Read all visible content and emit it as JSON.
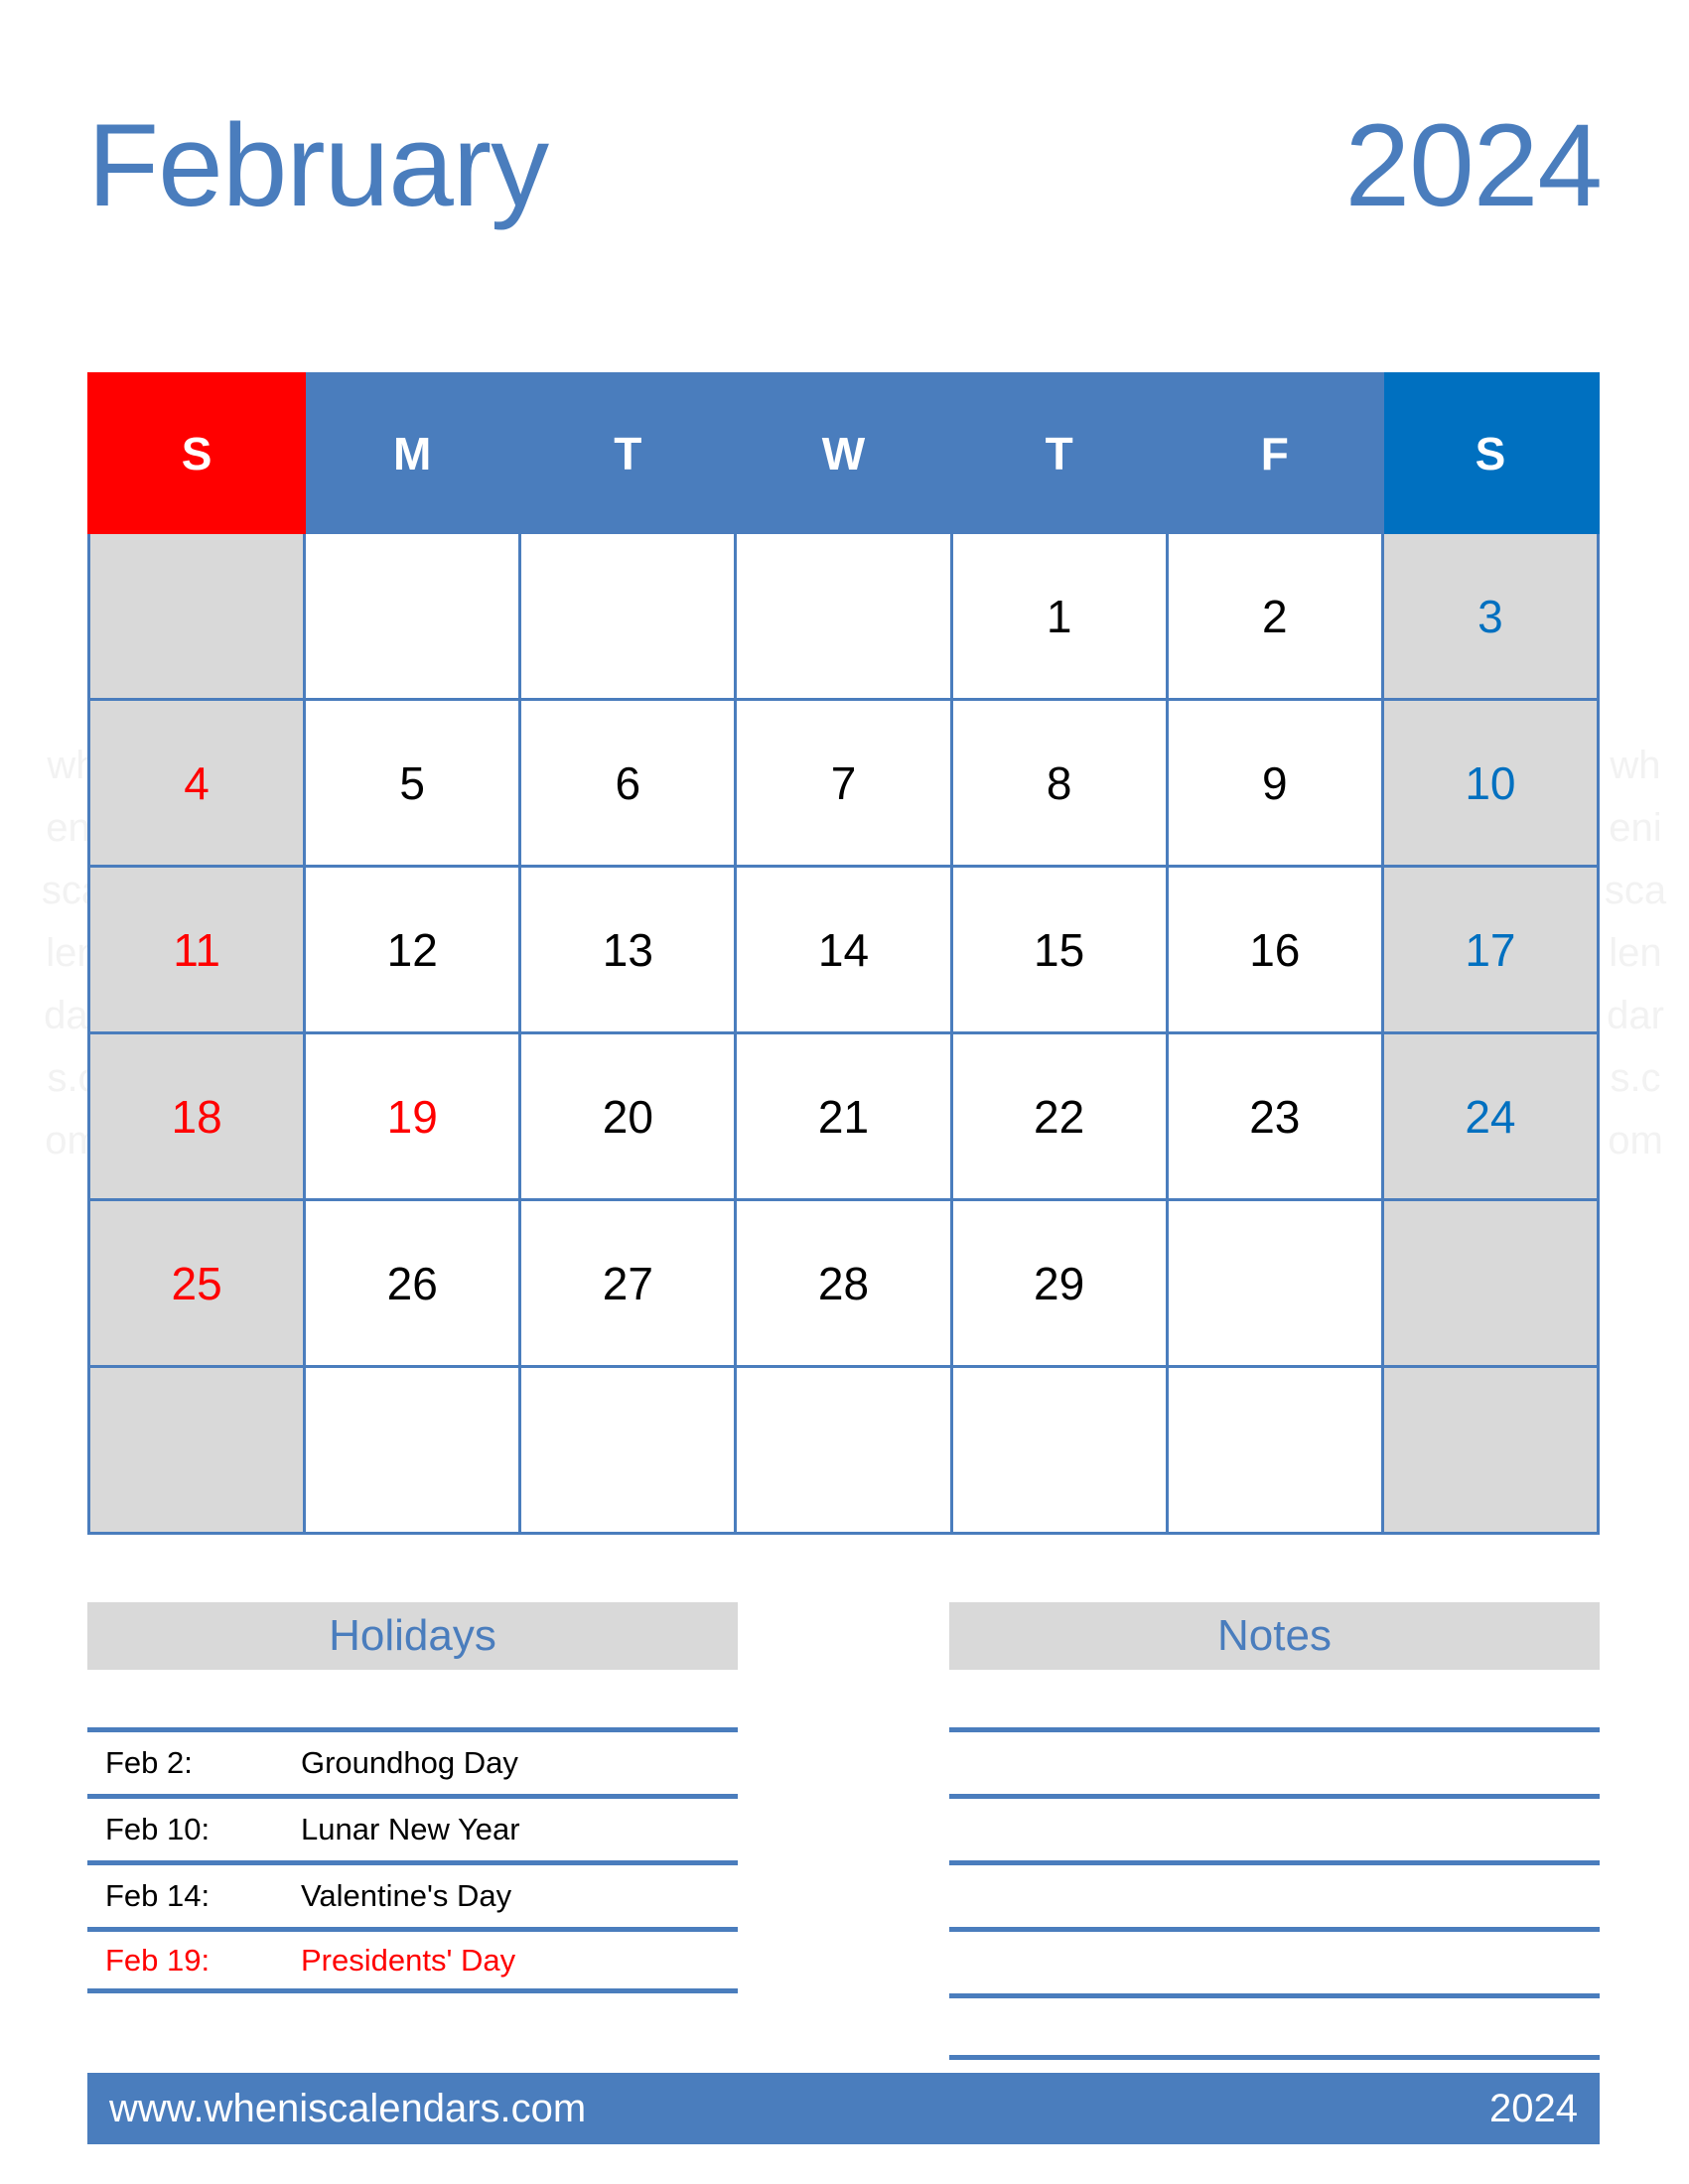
{
  "title": {
    "month": "February",
    "year": "2024"
  },
  "colors": {
    "accent_blue": "#4a7dbd",
    "saturday_blue": "#0070c0",
    "sunday_red": "#ff0000",
    "weekend_gray": "#d9d9d9",
    "panel_header_gray": "#d9d9d9"
  },
  "watermark": {
    "text": "wheniscalendars.com"
  },
  "calendar": {
    "weekday_headers": [
      {
        "label": "S",
        "kind": "sunday"
      },
      {
        "label": "M",
        "kind": "weekday"
      },
      {
        "label": "T",
        "kind": "weekday"
      },
      {
        "label": "W",
        "kind": "weekday"
      },
      {
        "label": "T",
        "kind": "weekday"
      },
      {
        "label": "F",
        "kind": "weekday"
      },
      {
        "label": "S",
        "kind": "saturday"
      }
    ],
    "weeks": [
      [
        {
          "day": "",
          "kind": "sunday"
        },
        {
          "day": "",
          "kind": "weekday"
        },
        {
          "day": "",
          "kind": "weekday"
        },
        {
          "day": "",
          "kind": "weekday"
        },
        {
          "day": "1",
          "kind": "weekday"
        },
        {
          "day": "2",
          "kind": "weekday"
        },
        {
          "day": "3",
          "kind": "saturday"
        }
      ],
      [
        {
          "day": "4",
          "kind": "sunday"
        },
        {
          "day": "5",
          "kind": "weekday"
        },
        {
          "day": "6",
          "kind": "weekday"
        },
        {
          "day": "7",
          "kind": "weekday"
        },
        {
          "day": "8",
          "kind": "weekday"
        },
        {
          "day": "9",
          "kind": "weekday"
        },
        {
          "day": "10",
          "kind": "saturday"
        }
      ],
      [
        {
          "day": "11",
          "kind": "sunday"
        },
        {
          "day": "12",
          "kind": "weekday"
        },
        {
          "day": "13",
          "kind": "weekday"
        },
        {
          "day": "14",
          "kind": "weekday"
        },
        {
          "day": "15",
          "kind": "weekday"
        },
        {
          "day": "16",
          "kind": "weekday"
        },
        {
          "day": "17",
          "kind": "saturday"
        }
      ],
      [
        {
          "day": "18",
          "kind": "sunday"
        },
        {
          "day": "19",
          "kind": "holiday"
        },
        {
          "day": "20",
          "kind": "weekday"
        },
        {
          "day": "21",
          "kind": "weekday"
        },
        {
          "day": "22",
          "kind": "weekday"
        },
        {
          "day": "23",
          "kind": "weekday"
        },
        {
          "day": "24",
          "kind": "saturday"
        }
      ],
      [
        {
          "day": "25",
          "kind": "sunday"
        },
        {
          "day": "26",
          "kind": "weekday"
        },
        {
          "day": "27",
          "kind": "weekday"
        },
        {
          "day": "28",
          "kind": "weekday"
        },
        {
          "day": "29",
          "kind": "weekday"
        },
        {
          "day": "",
          "kind": "weekday"
        },
        {
          "day": "",
          "kind": "saturday"
        }
      ],
      [
        {
          "day": "",
          "kind": "sunday"
        },
        {
          "day": "",
          "kind": "weekday"
        },
        {
          "day": "",
          "kind": "weekday"
        },
        {
          "day": "",
          "kind": "weekday"
        },
        {
          "day": "",
          "kind": "weekday"
        },
        {
          "day": "",
          "kind": "weekday"
        },
        {
          "day": "",
          "kind": "saturday"
        }
      ]
    ]
  },
  "holidays": {
    "heading": "Holidays",
    "items": [
      {
        "date": "Feb 2:",
        "name": "Groundhog Day",
        "highlight": false
      },
      {
        "date": "Feb 10:",
        "name": "Lunar New Year",
        "highlight": false
      },
      {
        "date": "Feb 14:",
        "name": "Valentine's Day",
        "highlight": false
      },
      {
        "date": "Feb 19:",
        "name": "Presidents' Day",
        "highlight": true
      }
    ]
  },
  "notes": {
    "heading": "Notes",
    "line_count": 5
  },
  "footer": {
    "website": "www.wheniscalendars.com",
    "year": "2024"
  }
}
